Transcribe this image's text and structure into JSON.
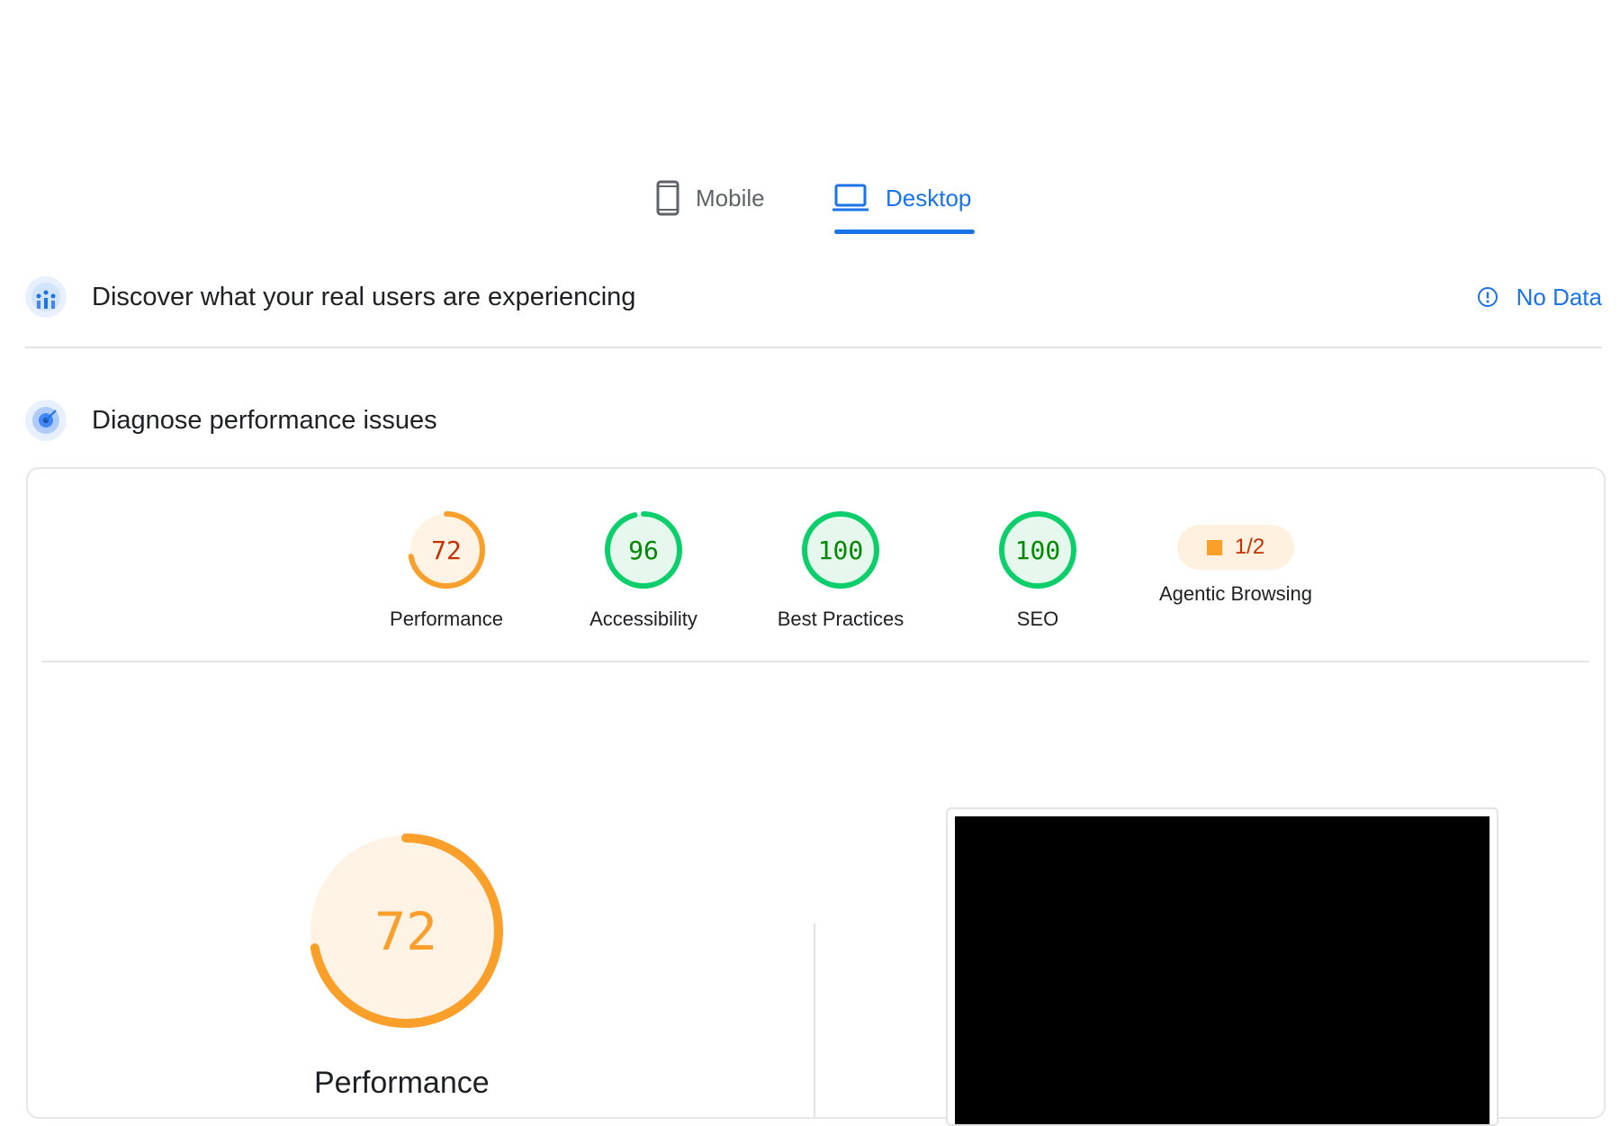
{
  "tabs": [
    {
      "label": "Mobile",
      "icon": "phone-icon",
      "active": false
    },
    {
      "label": "Desktop",
      "icon": "laptop-icon",
      "active": true
    }
  ],
  "crux": {
    "title": "Discover what your real users are experiencing",
    "status_label": "No Data",
    "status_icon": "info-icon"
  },
  "diagnose": {
    "title": "Diagnose performance issues"
  },
  "scores": [
    {
      "label": "Performance",
      "value": "72",
      "score": 72,
      "rating": "average"
    },
    {
      "label": "Accessibility",
      "value": "96",
      "score": 96,
      "rating": "pass"
    },
    {
      "label": "Best Practices",
      "value": "100",
      "score": 100,
      "rating": "pass"
    },
    {
      "label": "SEO",
      "value": "100",
      "score": 100,
      "rating": "pass"
    },
    {
      "label": "Agentic Browsing",
      "value": "1/2",
      "rating": "average"
    }
  ],
  "performance_detail": {
    "score": "72",
    "label": "Performance"
  },
  "colors": {
    "accent": "#1a73e8",
    "pass": "#0cce6b",
    "pass_text": "#008800",
    "pass_bg": "#e6f7ee",
    "average": "#fa9f2a",
    "average_text": "#c33300",
    "average_bg": "#fff3e5"
  }
}
